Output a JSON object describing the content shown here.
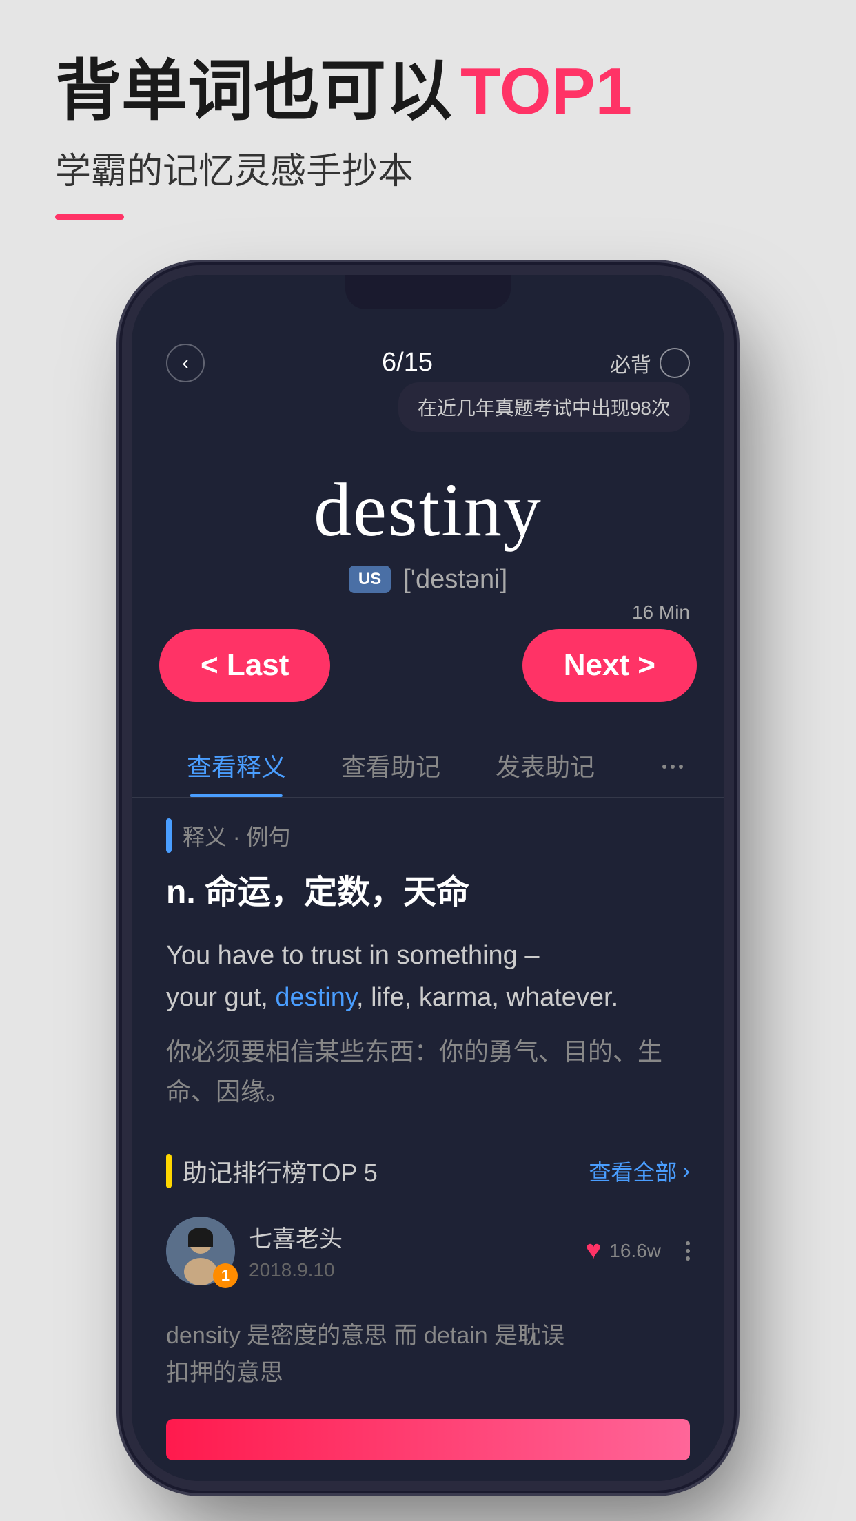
{
  "page": {
    "bg_color": "#e5e5e5"
  },
  "header": {
    "title_part1": "背单词也可以",
    "title_part2": "TOP1",
    "subtitle": "学霸的记忆灵感手抄本"
  },
  "phone": {
    "progress": "6/15",
    "must_memorize_label": "必背",
    "tooltip": "在近几年真题考试中出现98次",
    "word": "destiny",
    "phonetic_label": "US",
    "phonetic": "['destəni]",
    "time_label": "16 Min",
    "btn_last": "< Last",
    "btn_next": "Next >",
    "tabs": [
      {
        "label": "查看释义",
        "active": true
      },
      {
        "label": "查看助记",
        "active": false
      },
      {
        "label": "发表助记",
        "active": false
      }
    ],
    "section_definition_label": "释义 · 例句",
    "definition": "n.  命运，定数，天命",
    "example_en_before": "You have to trust in something –",
    "example_en_word": "destiny",
    "example_en_after": ", life, karma, whatever.",
    "example_en_full": "You have to trust in something – your gut, destiny, life, karma, whatever.",
    "example_zh": "你必须要相信某些东西：你的勇气、目的、生命、因缘。",
    "ranking_label": "助记排行榜TOP 5",
    "view_all": "查看全部",
    "ranking_item": {
      "username": "七喜老头",
      "date": "2018.9.10",
      "likes": "16.6w",
      "rank": "1",
      "avatar_emoji": "👩"
    },
    "memo_preview": "density 是密度的意思  而 detain 是耽误\n扣押的意思"
  }
}
